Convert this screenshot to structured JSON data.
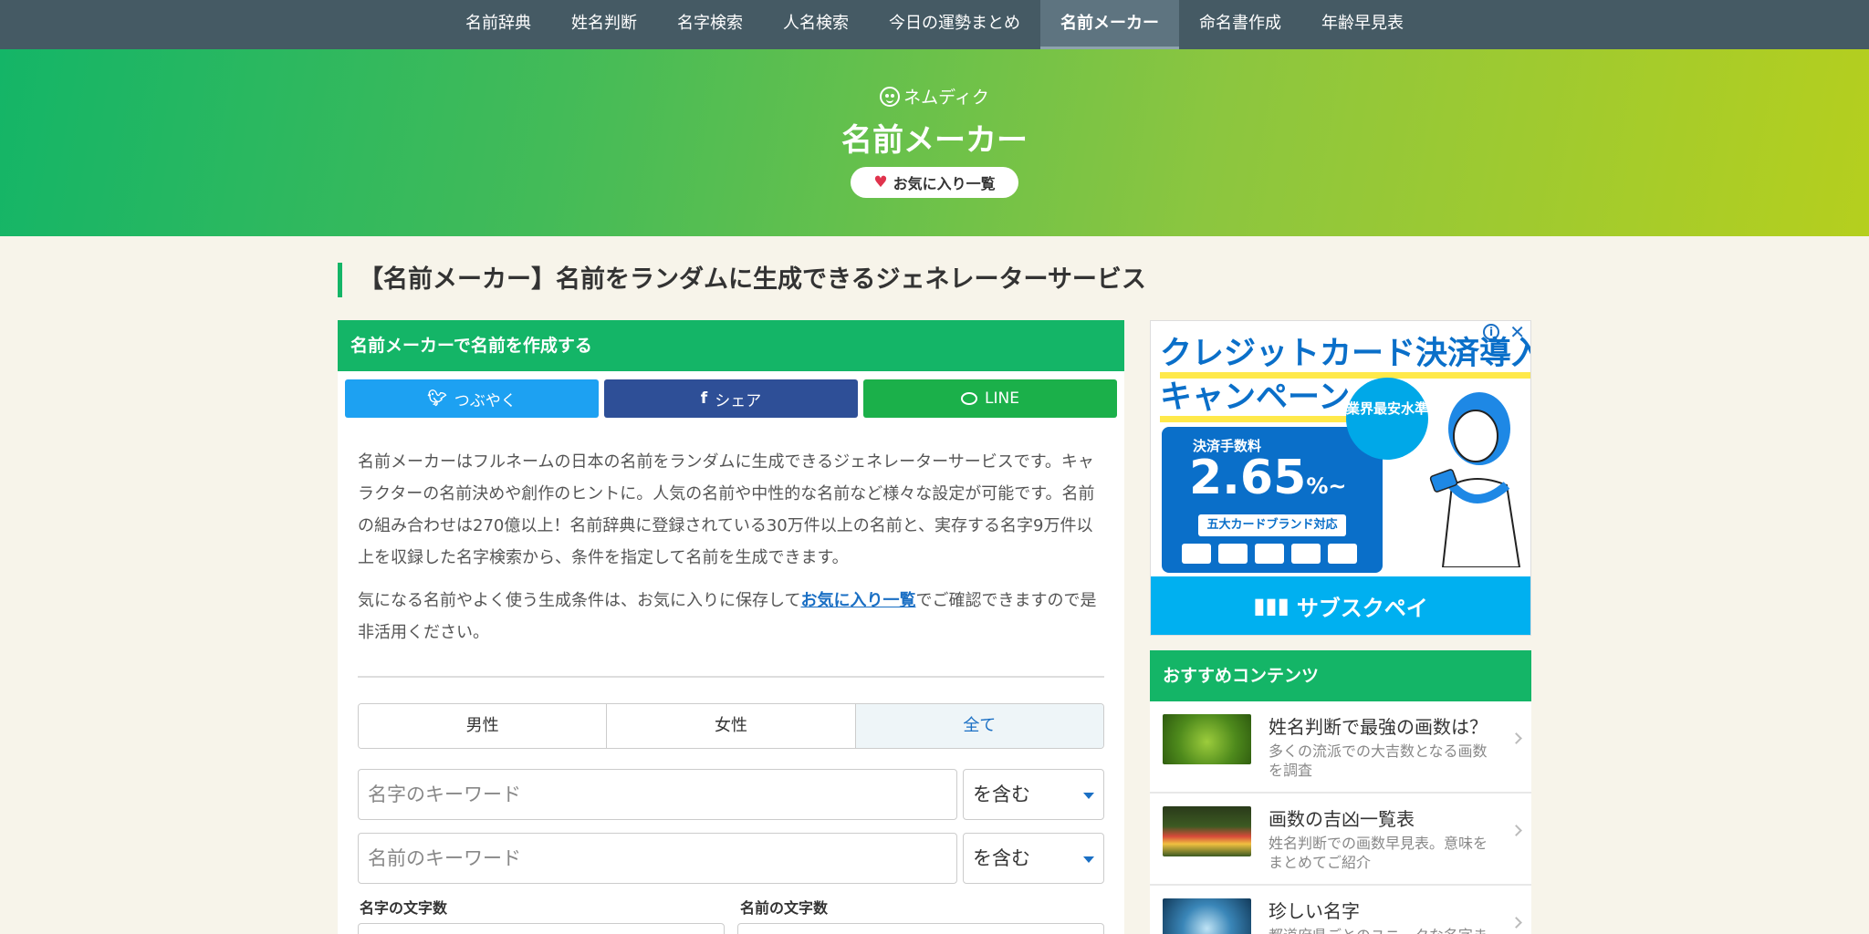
{
  "nav": {
    "items": [
      {
        "label": "名前辞典"
      },
      {
        "label": "姓名判断"
      },
      {
        "label": "名字検索"
      },
      {
        "label": "人名検索"
      },
      {
        "label": "今日の運勢まとめ"
      },
      {
        "label": "名前メーカー",
        "active": true
      },
      {
        "label": "命名書作成"
      },
      {
        "label": "年齢早見表"
      }
    ]
  },
  "hero": {
    "brand": "ネムディク",
    "title": "名前メーカー",
    "favorites_button": "お気に入り一覧"
  },
  "page_title": "【名前メーカー】名前をランダムに生成できるジェネレーターサービス",
  "card": {
    "header": "名前メーカーで名前を作成する",
    "share": {
      "twitter": "つぶやく",
      "facebook": "シェア",
      "line": "LINE"
    },
    "description_1": "名前メーカーはフルネームの日本の名前をランダムに生成できるジェネレーターサービスです。キャラクターの名前決めや創作のヒントに。人気の名前や中性的な名前など様々な設定が可能です。名前の組み合わせは270億以上！名前辞典に登録されている30万件以上の名前と、実存する名字9万件以上を収録した名字検索から、条件を指定して名前を生成できます。",
    "description_2_before": "気になる名前やよく使う生成条件は、お気に入りに保存して",
    "description_2_link": "お気に入り一覧",
    "description_2_after": "でご確認できますので是非活用ください。",
    "gender_tabs": [
      {
        "label": "男性"
      },
      {
        "label": "女性"
      },
      {
        "label": "全て",
        "active": true
      }
    ],
    "surname_keyword": {
      "placeholder": "名字のキーワード",
      "value": "",
      "match": "を含む"
    },
    "given_keyword": {
      "placeholder": "名前のキーワード",
      "value": "",
      "match": "を含む"
    },
    "surname_length_label": "名字の文字数",
    "given_length_label": "名前の文字数"
  },
  "ad": {
    "title_line1": "クレジットカード決済導入",
    "title_line2": "キャンペーン",
    "badge": "業界最安水準",
    "fee_label": "決済手数料",
    "fee_value": "2.65",
    "fee_unit": "%~",
    "brand_tag": "五大カードブランド対応",
    "footer": "サブスクペイ",
    "info_icon": "i",
    "close_icon": "✕"
  },
  "recommended": {
    "header": "おすすめコンテンツ",
    "items": [
      {
        "title": "姓名判断で最強の画数は？",
        "text": "多くの流派での大吉数となる画数を調査"
      },
      {
        "title": "画数の吉凶一覧表",
        "text": "姓名判断での画数早見表。意味をまとめてご紹介"
      },
      {
        "title": "珍しい名字",
        "text": "都道府県ごとのユニークな名字ま"
      }
    ]
  },
  "colors": {
    "accent": "#14b567",
    "nav_bg": "#455a64",
    "link": "#1a6fc4",
    "twitter": "#1da1f2",
    "facebook": "#2e4f97",
    "line": "#1bb04a"
  }
}
